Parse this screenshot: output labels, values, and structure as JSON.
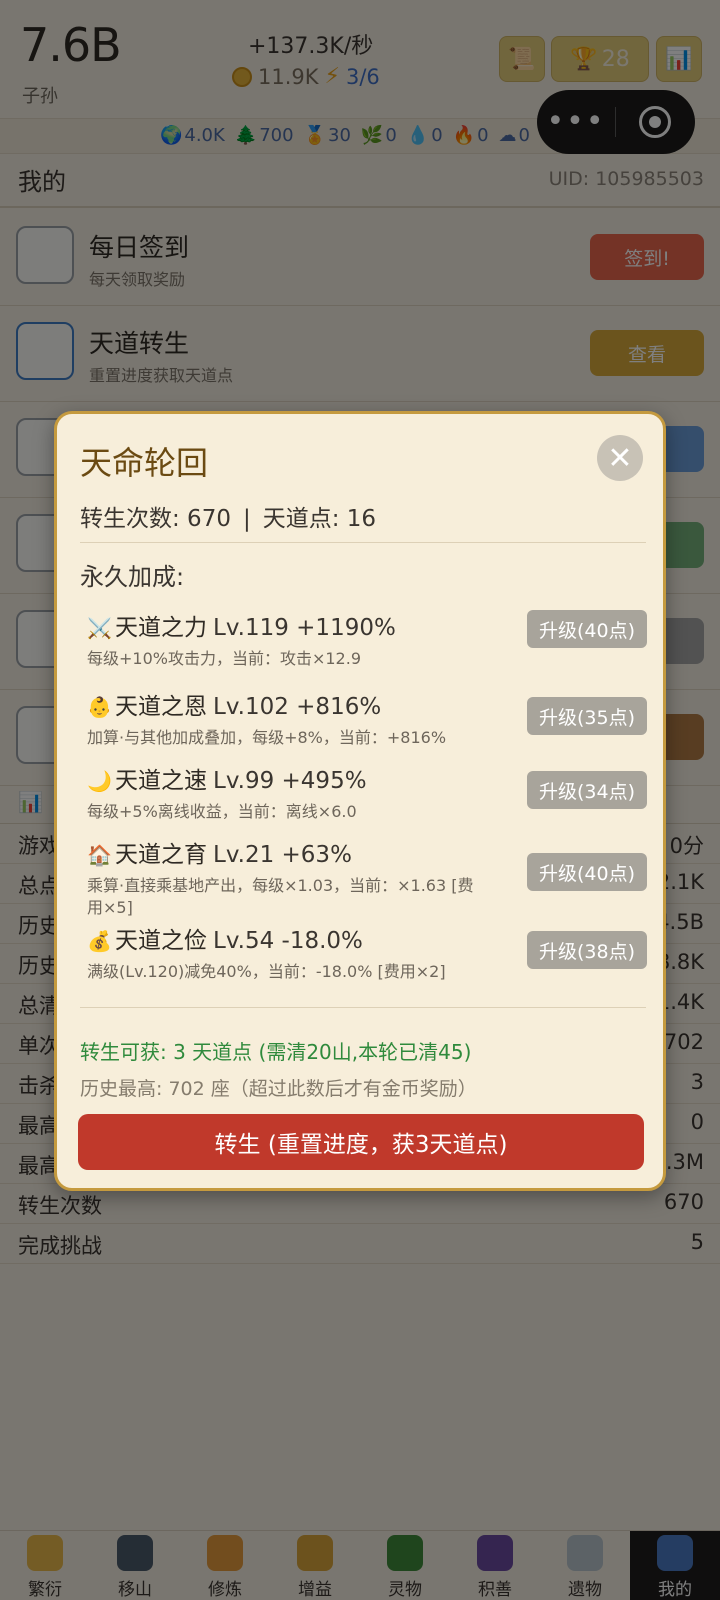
{
  "header": {
    "count": "7.6B",
    "unit": "子孙",
    "rate": "+137.3K/秒",
    "coins": "11.9K",
    "energy": "3/6",
    "trophy_count": "28"
  },
  "resources": [
    {
      "icon": "🌍",
      "value": "4.0K"
    },
    {
      "icon": "🌲",
      "value": "700"
    },
    {
      "icon": "🏅",
      "value": "30"
    },
    {
      "icon": "🌿",
      "value": "0"
    },
    {
      "icon": "💧",
      "value": "0"
    },
    {
      "icon": "🔥",
      "value": "0"
    },
    {
      "icon": "☁",
      "value": "0"
    }
  ],
  "page": {
    "title": "我的",
    "uid": "UID: 105985503"
  },
  "rows": [
    {
      "title": "每日签到",
      "subtitle": "每天领取奖励",
      "button": "签到!"
    },
    {
      "title": "天道转生",
      "subtitle": "重置进度获取天道点",
      "button": "查看"
    }
  ],
  "stats": [
    {
      "label": "游戏",
      "value": "0分"
    },
    {
      "label": "总点",
      "value": "2.1K"
    },
    {
      "label": "历史",
      "value": "4.5B"
    },
    {
      "label": "历史",
      "value": "8.8K"
    },
    {
      "label": "总清",
      "value": "1.4K"
    },
    {
      "label": "单次",
      "value": "702"
    },
    {
      "label": "击杀",
      "value": "3"
    },
    {
      "label": "最高",
      "value": "0"
    },
    {
      "label": "最高",
      "value": "3.3M"
    },
    {
      "label": "转生次数",
      "value": "670"
    },
    {
      "label": "完成挑战",
      "value": "5"
    }
  ],
  "nav": [
    {
      "label": "繁衍",
      "color": "#e8b84a"
    },
    {
      "label": "移山",
      "color": "#4a5a6a"
    },
    {
      "label": "修炼",
      "color": "#e49a3c"
    },
    {
      "label": "增益",
      "color": "#d9a43a"
    },
    {
      "label": "灵物",
      "color": "#3f8a3a"
    },
    {
      "label": "积善",
      "color": "#6b4aa0"
    },
    {
      "label": "遗物",
      "color": "#b8c4cc"
    },
    {
      "label": "我的",
      "color": "#4a7ac4"
    }
  ],
  "modal": {
    "title": "天命轮回",
    "rebirth_label": "转生次数: 670",
    "points_label": "天道点: 16",
    "separator": "|",
    "bonus_heading": "永久加成:",
    "bonuses": [
      {
        "emoji": "⚔️",
        "name": "天道之力",
        "level": "Lv.119 +1190%",
        "desc": "每级+10%攻击力，当前：攻击×12.9",
        "button": "升级(40点)"
      },
      {
        "emoji": "👶",
        "name": "天道之恩",
        "level": "Lv.102 +816%",
        "desc": "加算·与其他加成叠加，每级+8%，当前：+816%",
        "button": "升级(35点)"
      },
      {
        "emoji": "🌙",
        "name": "天道之速",
        "level": "Lv.99 +495%",
        "desc": "每级+5%离线收益，当前：离线×6.0",
        "button": "升级(34点)"
      },
      {
        "emoji": "🏠",
        "name": "天道之育",
        "level": "Lv.21 +63%",
        "desc": "乘算·直接乘基地产出，每级×1.03，当前：×1.63 [费用×5]",
        "button": "升级(40点)"
      },
      {
        "emoji": "💰",
        "name": "天道之俭",
        "level": "Lv.54 -18.0%",
        "desc": "满级(Lv.120)减免40%，当前：-18.0% [费用×2]",
        "button": "升级(38点)"
      }
    ],
    "gain": "转生可获: 3 天道点 (需清20山,本轮已清45)",
    "record": "历史最高: 702 座（超过此数后才有金币奖励）",
    "action": "转生 (重置进度，获3天道点)"
  }
}
